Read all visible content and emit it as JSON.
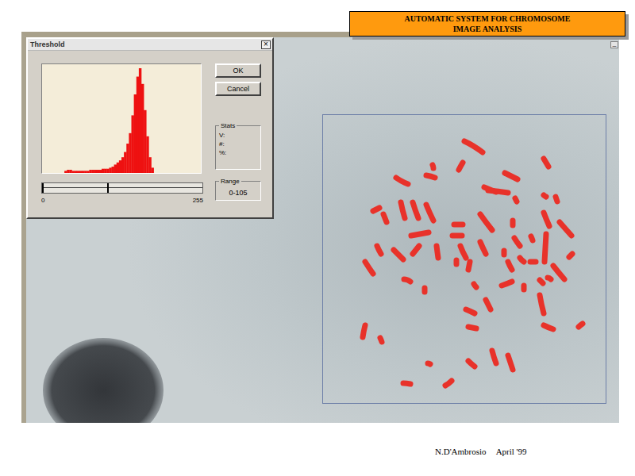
{
  "header": {
    "title": "AUTOMATIC SYSTEM FOR CHROMOSOME IMAGE ANALYSIS"
  },
  "image_window": {
    "minimize": "_"
  },
  "dialog": {
    "title": "Threshold",
    "close": "×",
    "histogram": {
      "values": [
        0,
        0,
        0,
        0,
        0,
        0,
        0,
        0,
        0,
        2,
        3,
        3,
        2,
        2,
        2,
        2,
        2,
        2,
        2,
        3,
        3,
        3,
        3,
        3,
        4,
        4,
        4,
        5,
        6,
        8,
        10,
        12,
        15,
        20,
        28,
        38,
        55,
        75,
        92,
        100,
        85,
        60,
        35,
        15,
        5,
        0,
        0,
        0,
        0,
        0,
        0,
        0,
        0,
        0,
        0,
        0,
        0,
        0,
        0,
        0,
        0,
        0,
        0,
        0
      ]
    },
    "slider": {
      "level": 0.41,
      "min": "0",
      "max": "255"
    },
    "buttons": [
      "OK",
      "Cancel"
    ],
    "stats": {
      "label": "Stats",
      "fields": [
        "V:",
        "#:",
        "%:"
      ]
    },
    "range": {
      "label": "Range",
      "value": "0-105"
    }
  },
  "footer": {
    "author": "N.D'Ambrosio",
    "date": "April '99"
  }
}
